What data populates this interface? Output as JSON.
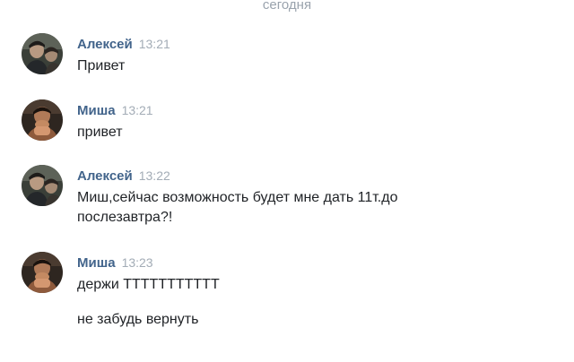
{
  "chat": {
    "date_divider": "сегодня",
    "messages": [
      {
        "author": "Алексей",
        "time": "13:21",
        "avatar_icon": "user-photo-icon",
        "lines": [
          "Привет"
        ]
      },
      {
        "author": "Миша",
        "time": "13:21",
        "avatar_icon": "user-photo-icon",
        "lines": [
          "привет"
        ]
      },
      {
        "author": "Алексей",
        "time": "13:22",
        "avatar_icon": "user-photo-icon",
        "lines": [
          "Миш,сейчас возможность будет мне дать 11т.до послезавтра?!"
        ]
      },
      {
        "author": "Миша",
        "time": "13:23",
        "avatar_icon": "user-photo-icon",
        "lines": [
          "держи ТТТТТТТТТТТ",
          "не забудь вернуть"
        ]
      }
    ]
  },
  "colors": {
    "author_name": "#42648b",
    "timestamp": "#a3acb6",
    "message_text": "#1f2226",
    "date_divider": "#9aa3ad"
  }
}
